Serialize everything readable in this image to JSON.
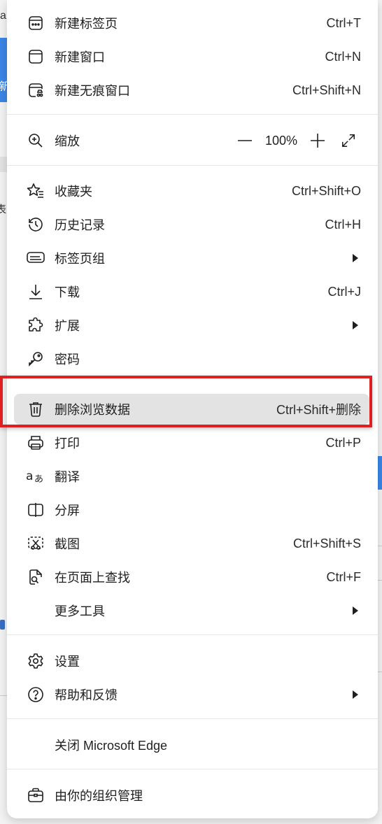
{
  "background": {
    "top_left_text": "a",
    "left_blue_text": "新",
    "left_side_text": "表"
  },
  "menu": {
    "new_tab": {
      "label": "新建标签页",
      "shortcut": "Ctrl+T"
    },
    "new_window": {
      "label": "新建窗口",
      "shortcut": "Ctrl+N"
    },
    "new_inprivate": {
      "label": "新建无痕窗口",
      "shortcut": "Ctrl+Shift+N"
    },
    "zoom": {
      "label": "缩放",
      "value": "100%"
    },
    "favorites": {
      "label": "收藏夹",
      "shortcut": "Ctrl+Shift+O"
    },
    "history": {
      "label": "历史记录",
      "shortcut": "Ctrl+H"
    },
    "tab_groups": {
      "label": "标签页组"
    },
    "downloads": {
      "label": "下载",
      "shortcut": "Ctrl+J"
    },
    "extensions": {
      "label": "扩展"
    },
    "passwords": {
      "label": "密码"
    },
    "clear_data": {
      "label": "删除浏览数据",
      "shortcut": "Ctrl+Shift+删除"
    },
    "print": {
      "label": "打印",
      "shortcut": "Ctrl+P"
    },
    "translate": {
      "label": "翻译"
    },
    "split_screen": {
      "label": "分屏"
    },
    "screenshot": {
      "label": "截图",
      "shortcut": "Ctrl+Shift+S"
    },
    "find": {
      "label": "在页面上查找",
      "shortcut": "Ctrl+F"
    },
    "more_tools": {
      "label": "更多工具"
    },
    "settings": {
      "label": "设置"
    },
    "help": {
      "label": "帮助和反馈"
    },
    "close_edge": {
      "label": "关闭 Microsoft Edge"
    },
    "org_managed": {
      "label": "由你的组织管理"
    }
  },
  "colors": {
    "highlight_box": "#e02020",
    "accent_blue": "#3a86e8",
    "hover_bg": "#e3e3e3"
  }
}
